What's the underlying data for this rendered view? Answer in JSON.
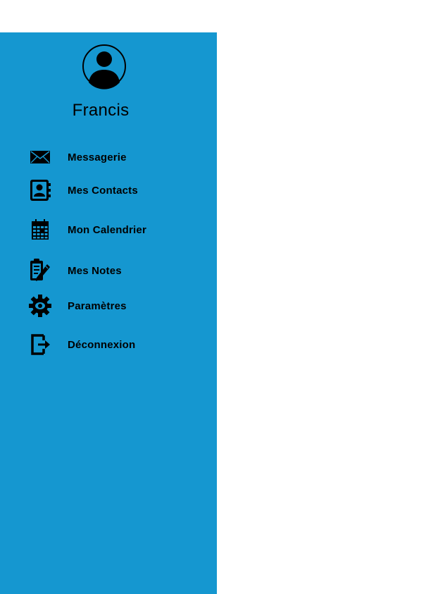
{
  "user": {
    "name": "Francis"
  },
  "menu": {
    "items": [
      {
        "label": "Messagerie",
        "icon": "envelope-icon"
      },
      {
        "label": "Mes Contacts",
        "icon": "contacts-book-icon"
      },
      {
        "label": "Mon Calendrier",
        "icon": "calendar-icon"
      },
      {
        "label": "Mes Notes",
        "icon": "clipboard-pencil-icon"
      },
      {
        "label": "Paramètres",
        "icon": "gear-icon"
      },
      {
        "label": "Déconnexion",
        "icon": "logout-icon"
      }
    ]
  },
  "colors": {
    "drawer_background": "#1597d0",
    "page_background": "#ffffff",
    "text": "#000000"
  }
}
